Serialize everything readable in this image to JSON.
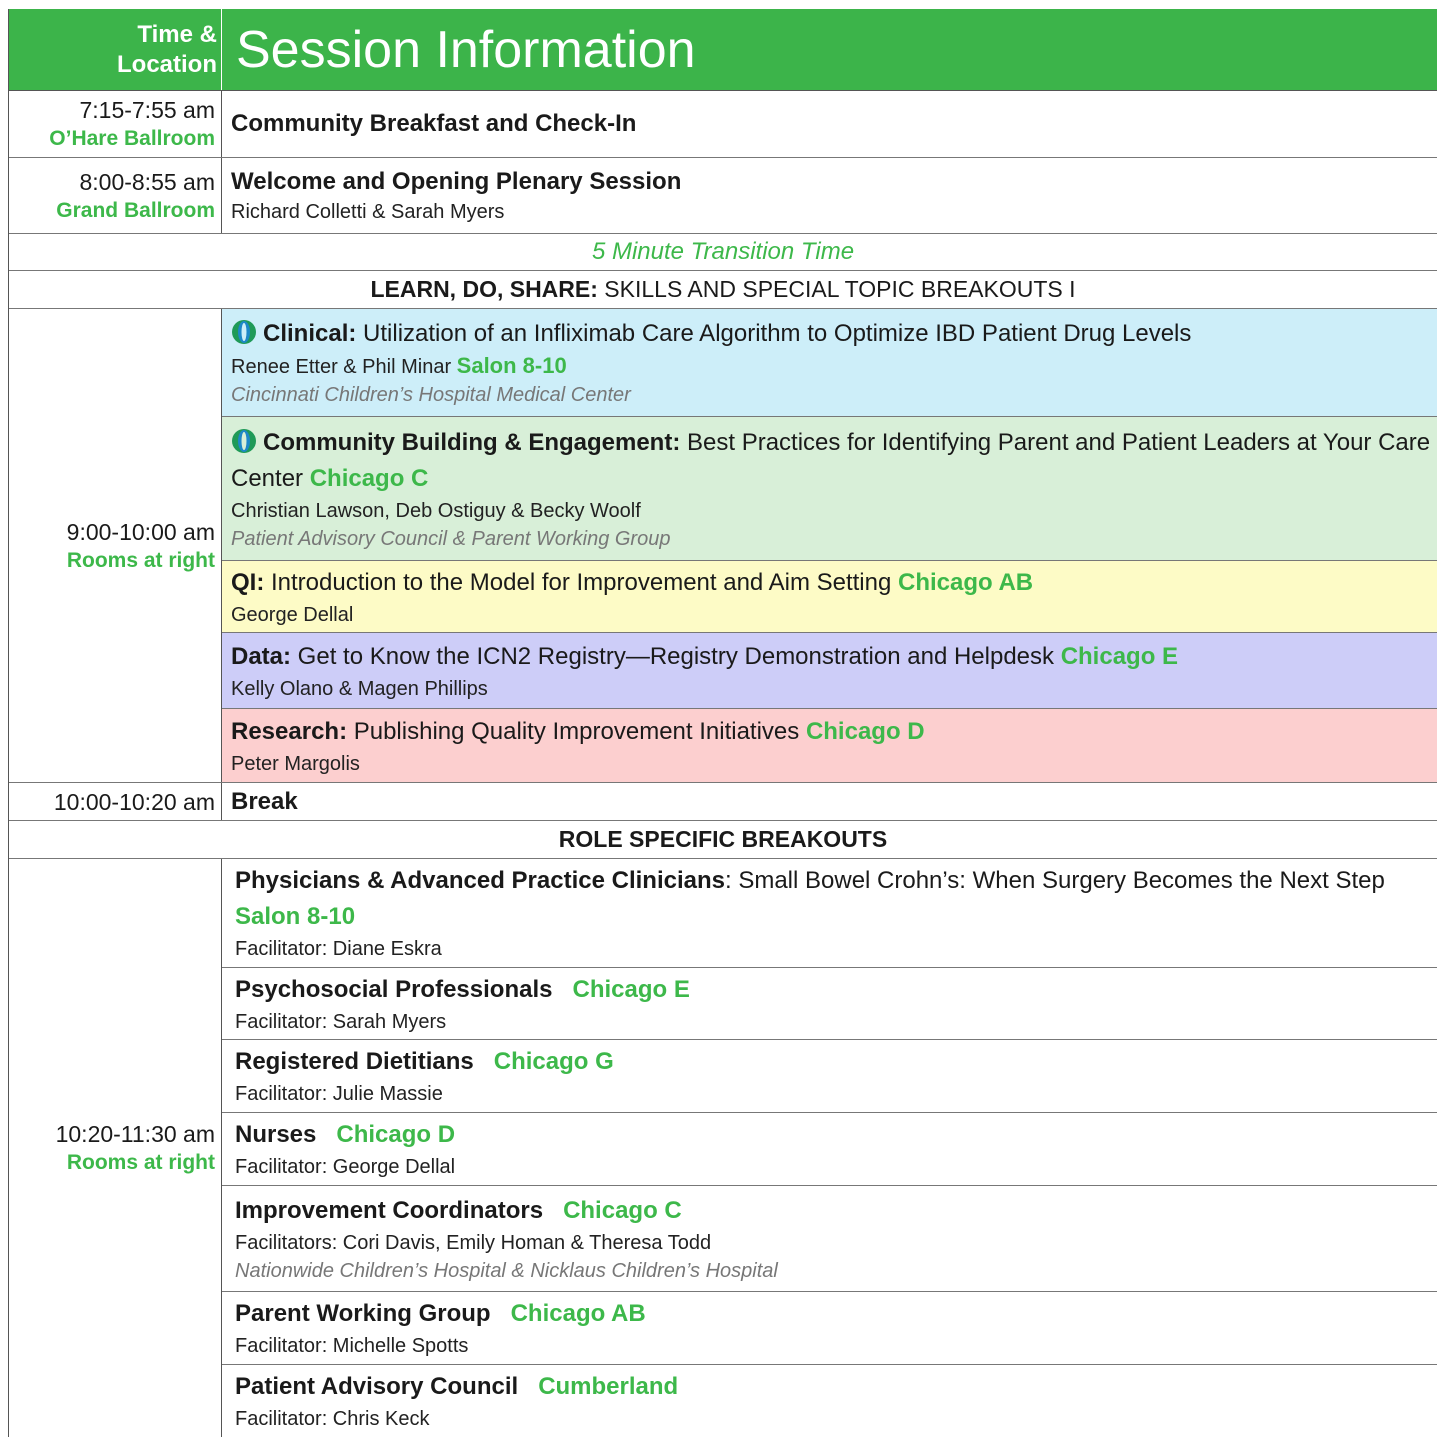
{
  "header": {
    "time_label_1": "Time &",
    "time_label_2": "Location",
    "title": "Session Information"
  },
  "colors": {
    "green": "#3cb44a",
    "clinical": "#cdeef9",
    "community": "#d8efd8",
    "qi": "#fdfbc6",
    "data": "#cdcdf8",
    "research": "#fccfcf"
  },
  "rows": {
    "breakfast": {
      "time": "7:15-7:55 am",
      "location": "O’Hare Ballroom",
      "title": "Community Breakfast and Check-In"
    },
    "welcome": {
      "time": "8:00-8:55 am",
      "location": "Grand Ballroom",
      "title": "Welcome and Opening Plenary Session",
      "speakers": "Richard Colletti & Sarah Myers"
    },
    "transition": "5 Minute Transition Time",
    "section1": {
      "bold": "LEARN, DO, SHARE:",
      "rest": " SKILLS AND SPECIAL TOPIC BREAKOUTS I"
    },
    "breakout1": {
      "time": "9:00-10:00 am",
      "location": "Rooms at right",
      "sessions": [
        {
          "label": "Clinical:",
          "title": " Utilization of an Infliximab Care Algorithm to Optimize IBD Patient Drug Levels",
          "speakers": "Renee Etter & Phil Minar ",
          "room": "Salon 8-10",
          "org": "Cincinnati Children’s Hospital Medical Center",
          "icon": "icn-logo-icon"
        },
        {
          "label": "Community Building & Engagement:",
          "title": " Best Practices for Identifying Parent and Patient Leaders at Your Care Center ",
          "room": "Chicago C",
          "speakers": "Christian Lawson, Deb Ostiguy & Becky Woolf",
          "org": "Patient Advisory Council & Parent Working Group",
          "icon": "icn-logo-icon"
        },
        {
          "label": "QI:",
          "title": " Introduction to the Model for Improvement and Aim Setting ",
          "room": "Chicago AB",
          "speakers": "George Dellal"
        },
        {
          "label": "Data:",
          "title": " Get to Know the ICN2 Registry—Registry Demonstration and Helpdesk ",
          "room": "Chicago E",
          "speakers": "Kelly Olano & Magen Phillips"
        },
        {
          "label": "Research:",
          "title": " Publishing Quality Improvement Initiatives ",
          "room": "Chicago D",
          "speakers": "Peter Margolis"
        }
      ]
    },
    "break": {
      "time": "10:00-10:20 am",
      "title": "Break"
    },
    "section2": "ROLE SPECIFIC BREAKOUTS",
    "breakout2": {
      "time": "10:20-11:30 am",
      "location": "Rooms at right",
      "sessions": [
        {
          "label": "Physicians & Advanced Practice Clinicians",
          "title": ": Small Bowel Crohn’s: When Surgery Becomes the Next Step  ",
          "room": "Salon 8-10",
          "speakers": "Facilitator: Diane Eskra"
        },
        {
          "label": "Psychosocial Professionals",
          "room": "Chicago E",
          "speakers": "Facilitator: Sarah Myers"
        },
        {
          "label": "Registered Dietitians",
          "room": "Chicago G",
          "speakers": "Facilitator: Julie Massie"
        },
        {
          "label": "Nurses",
          "room": "Chicago D",
          "speakers": "Facilitator: George Dellal"
        },
        {
          "label": "Improvement Coordinators",
          "room": "Chicago C",
          "speakers": "Facilitators: Cori Davis, Emily Homan & Theresa Todd",
          "org": "Nationwide Children’s Hospital & Nicklaus Children’s Hospital"
        },
        {
          "label": "Parent Working Group",
          "room": "Chicago AB",
          "speakers": "Facilitator: Michelle Spotts"
        },
        {
          "label": "Patient Advisory Council",
          "room": "Cumberland",
          "speakers": "Facilitator: Chris Keck"
        }
      ]
    }
  }
}
